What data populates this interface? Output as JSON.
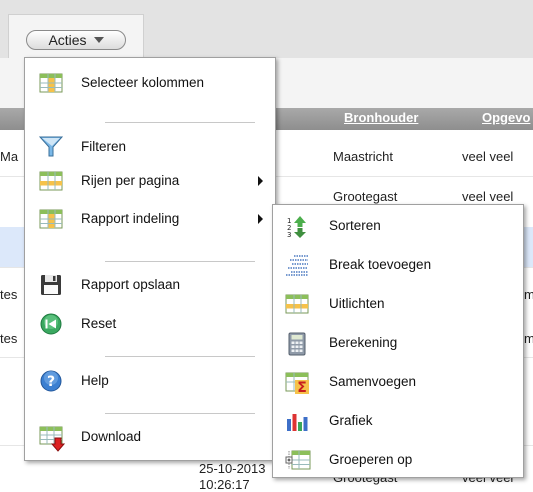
{
  "toolbar": {
    "actions_label": "Acties"
  },
  "table": {
    "headers": {
      "bronhouder": "Bronhouder",
      "opgevoerd": "Opgevo"
    },
    "rows": [
      {
        "left": "Ma",
        "bronhouder": "Maastricht",
        "extra": "veel veel"
      },
      {
        "left": "",
        "bronhouder": "Grootegast",
        "extra": "veel veel"
      },
      {
        "left": "tes",
        "bronhouder": "",
        "extra": "m"
      },
      {
        "left": "tes",
        "bronhouder": "",
        "extra": "m"
      },
      {
        "left": "",
        "bronhouder": "Grootegast",
        "extra": "veel veel"
      }
    ],
    "bottom_date": "25-10-2013",
    "bottom_time": "10:26:17"
  },
  "actions_menu": {
    "items": [
      {
        "label": "Selecteer kolommen",
        "icon": "table-columns-icon"
      },
      {
        "label": "Filteren",
        "icon": "funnel-icon"
      },
      {
        "label": "Rijen per pagina",
        "icon": "table-rows-icon",
        "submenu": true
      },
      {
        "label": "Rapport indeling",
        "icon": "table-layout-icon",
        "submenu": true
      },
      {
        "label": "Rapport opslaan",
        "icon": "floppy-disk-icon"
      },
      {
        "label": "Reset",
        "icon": "reset-icon"
      },
      {
        "label": "Help",
        "icon": "help-icon"
      },
      {
        "label": "Download",
        "icon": "download-icon"
      }
    ]
  },
  "report_layout_submenu": {
    "items": [
      {
        "label": "Sorteren",
        "icon": "sort-icon"
      },
      {
        "label": "Break toevoegen",
        "icon": "break-icon"
      },
      {
        "label": "Uitlichten",
        "icon": "highlight-icon"
      },
      {
        "label": "Berekening",
        "icon": "calculator-icon"
      },
      {
        "label": "Samenvoegen",
        "icon": "sum-icon"
      },
      {
        "label": "Grafiek",
        "icon": "bar-chart-icon"
      },
      {
        "label": "Groeperen op",
        "icon": "group-by-icon"
      }
    ]
  },
  "colors": {
    "header_bar": "#999999",
    "highlight_row": "#dce8fa",
    "toolbar_bg": "#e3e3e3"
  }
}
